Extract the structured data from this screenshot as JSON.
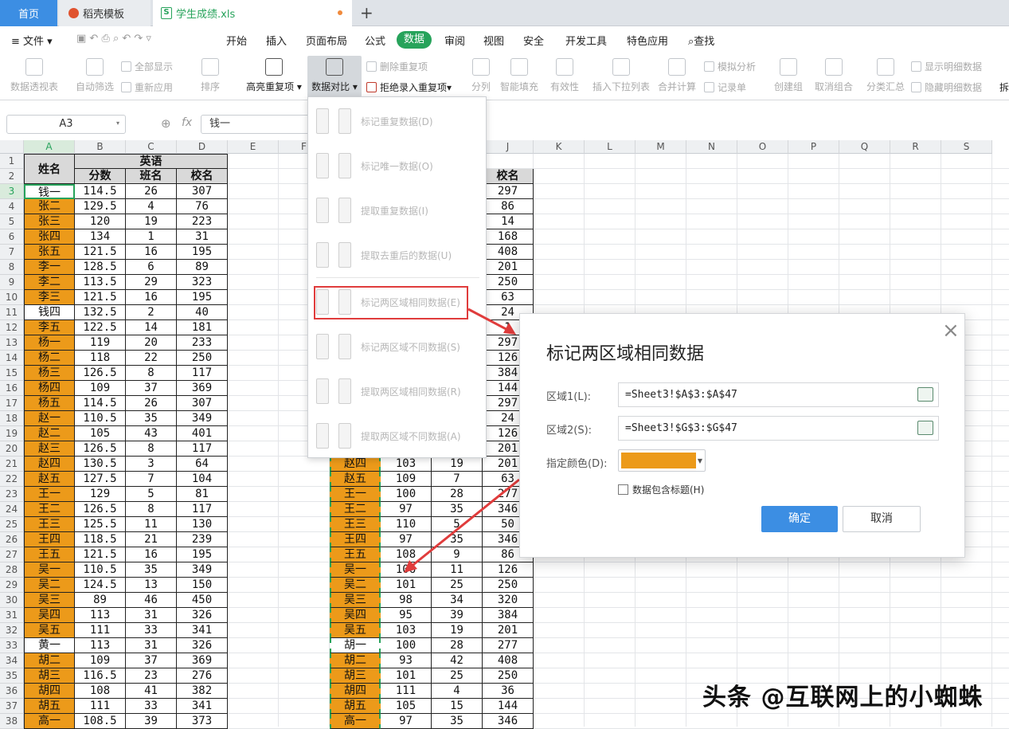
{
  "tabs": {
    "home": "首页",
    "templates": "稻壳模板",
    "file": "学生成绩.xls"
  },
  "menu": {
    "file": "文件",
    "items": [
      "开始",
      "插入",
      "页面布局",
      "公式",
      "数据",
      "审阅",
      "视图",
      "安全",
      "开发工具",
      "特色应用"
    ],
    "search": "查找"
  },
  "ribbon": {
    "pivot": "数据透视表",
    "auto_filter": "自动筛选",
    "show_all": "全部显示",
    "reapply": "重新应用",
    "sort": "排序",
    "highlight_dup": "高亮重复项",
    "compare": "数据对比",
    "delete_dup": "删除重复项",
    "reject_dup": "拒绝录入重复项",
    "split": "分列",
    "fill": "智能填充",
    "validity": "有效性",
    "insert_dropdown": "插入下拉列表",
    "consolidate": "合并计算",
    "what_if": "模拟分析",
    "record_sheet": "记录单",
    "create_group": "创建组",
    "ungroup": "取消组合",
    "subtotal": "分类汇总",
    "show_detail": "显示明细数据",
    "hide_detail": "隐藏明细数据",
    "more": "拆"
  },
  "formula_bar": {
    "name_box": "A3",
    "fx": "fx",
    "value": "钱一"
  },
  "columns": [
    "A",
    "B",
    "C",
    "D",
    "E",
    "F",
    "G",
    "H",
    "I",
    "J",
    "K",
    "L",
    "M",
    "N",
    "O",
    "P",
    "Q",
    "R",
    "S"
  ],
  "rows": [
    "1",
    "2",
    "3",
    "4",
    "5",
    "6",
    "7",
    "8",
    "9",
    "10",
    "11",
    "12",
    "13",
    "14",
    "15",
    "16",
    "17",
    "18",
    "19",
    "20",
    "21",
    "22",
    "23",
    "24",
    "25",
    "26",
    "27",
    "28",
    "29",
    "30",
    "31",
    "32",
    "33",
    "34",
    "35",
    "36",
    "37",
    "38"
  ],
  "table1": {
    "name_header": "姓名",
    "group_header": "英语",
    "sub_headers": [
      "分数",
      "班名",
      "校名"
    ],
    "rows": [
      [
        "钱一",
        "114.5",
        "26",
        "307"
      ],
      [
        "张二",
        "129.5",
        "4",
        "76"
      ],
      [
        "张三",
        "120",
        "19",
        "223"
      ],
      [
        "张四",
        "134",
        "1",
        "31"
      ],
      [
        "张五",
        "121.5",
        "16",
        "195"
      ],
      [
        "李一",
        "128.5",
        "6",
        "89"
      ],
      [
        "李二",
        "113.5",
        "29",
        "323"
      ],
      [
        "李三",
        "121.5",
        "16",
        "195"
      ],
      [
        "钱四",
        "132.5",
        "2",
        "40"
      ],
      [
        "李五",
        "122.5",
        "14",
        "181"
      ],
      [
        "杨一",
        "119",
        "20",
        "233"
      ],
      [
        "杨二",
        "118",
        "22",
        "250"
      ],
      [
        "杨三",
        "126.5",
        "8",
        "117"
      ],
      [
        "杨四",
        "109",
        "37",
        "369"
      ],
      [
        "杨五",
        "114.5",
        "26",
        "307"
      ],
      [
        "赵一",
        "110.5",
        "35",
        "349"
      ],
      [
        "赵二",
        "105",
        "43",
        "401"
      ],
      [
        "赵三",
        "126.5",
        "8",
        "117"
      ],
      [
        "赵四",
        "130.5",
        "3",
        "64"
      ],
      [
        "赵五",
        "127.5",
        "7",
        "104"
      ],
      [
        "王一",
        "129",
        "5",
        "81"
      ],
      [
        "王二",
        "126.5",
        "8",
        "117"
      ],
      [
        "王三",
        "125.5",
        "11",
        "130"
      ],
      [
        "王四",
        "118.5",
        "21",
        "239"
      ],
      [
        "王五",
        "121.5",
        "16",
        "195"
      ],
      [
        "吴一",
        "110.5",
        "35",
        "349"
      ],
      [
        "吴二",
        "124.5",
        "13",
        "150"
      ],
      [
        "吴三",
        "89",
        "46",
        "450"
      ],
      [
        "吴四",
        "113",
        "31",
        "326"
      ],
      [
        "吴五",
        "111",
        "33",
        "341"
      ],
      [
        "黄一",
        "113",
        "31",
        "326"
      ],
      [
        "胡二",
        "109",
        "37",
        "369"
      ],
      [
        "胡三",
        "116.5",
        "23",
        "276"
      ],
      [
        "胡四",
        "108",
        "41",
        "382"
      ],
      [
        "胡五",
        "111",
        "33",
        "341"
      ],
      [
        "高一",
        "108.5",
        "39",
        "373"
      ]
    ]
  },
  "table2": {
    "header_j": "校名",
    "j_values": [
      "297",
      "86",
      "14",
      "168",
      "408",
      "201",
      "250",
      "63",
      "24",
      "1",
      "297",
      "126",
      "384",
      "144",
      "297",
      "24",
      "126",
      "201"
    ],
    "rows": [
      [
        "赵四",
        "103",
        "19",
        "201"
      ],
      [
        "赵五",
        "109",
        "7",
        "63"
      ],
      [
        "王一",
        "100",
        "28",
        "277"
      ],
      [
        "王二",
        "97",
        "35",
        "346"
      ],
      [
        "王三",
        "110",
        "5",
        "50"
      ],
      [
        "王四",
        "97",
        "35",
        "346"
      ],
      [
        "王五",
        "108",
        "9",
        "86"
      ],
      [
        "吴一",
        "106",
        "11",
        "126"
      ],
      [
        "吴二",
        "101",
        "25",
        "250"
      ],
      [
        "吴三",
        "98",
        "34",
        "320"
      ],
      [
        "吴四",
        "95",
        "39",
        "384"
      ],
      [
        "吴五",
        "103",
        "19",
        "201"
      ],
      [
        "胡一",
        "100",
        "28",
        "277"
      ],
      [
        "胡二",
        "93",
        "42",
        "408"
      ],
      [
        "胡三",
        "101",
        "25",
        "250"
      ],
      [
        "胡四",
        "111",
        "4",
        "36"
      ],
      [
        "胡五",
        "105",
        "15",
        "144"
      ],
      [
        "高一",
        "97",
        "35",
        "346"
      ]
    ]
  },
  "dropdown": [
    "标记重复数据(D)",
    "标记唯一数据(O)",
    "提取重复数据(I)",
    "提取去重后的数据(U)",
    "标记两区域相同数据(E)",
    "标记两区域不同数据(S)",
    "提取两区域相同数据(R)",
    "提取两区域不同数据(A)"
  ],
  "dialog": {
    "title": "标记两区域相同数据",
    "area1_label": "区域1(L):",
    "area1_value": "=Sheet3!$A$3:$A$47",
    "area2_label": "区域2(S):",
    "area2_value": "=Sheet3!$G$3:$G$47",
    "color_label": "指定颜色(D):",
    "color": "#ec9a1a",
    "checkbox_label": "数据包含标题(H)",
    "checkbox_checked": false,
    "ok": "确定",
    "cancel": "取消"
  },
  "watermark": "头条 @互联网上的小蜘蛛",
  "colors": {
    "accent": "#27a35b",
    "tab_active": "#3c8ee3",
    "match": "#ec9a1a",
    "highlight_border": "#e03c3c"
  }
}
